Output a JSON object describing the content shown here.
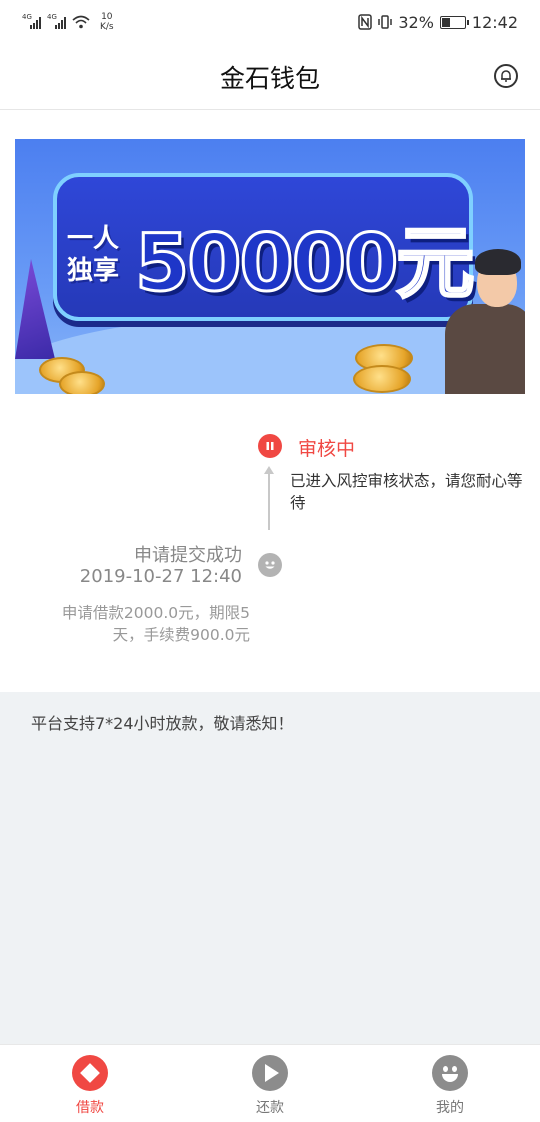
{
  "status_bar": {
    "signal1_label": "4G",
    "signal2_label": "4G",
    "speed_value": "10",
    "speed_unit": "K/s",
    "battery_percent": "32%",
    "time": "12:42",
    "nfc_icon": "nfc-icon",
    "vibrate_icon": "vibrate-icon"
  },
  "header": {
    "title": "金石钱包",
    "bell_icon": "bell-icon"
  },
  "banner": {
    "small_text_line1": "一人",
    "small_text_line2": "独享",
    "amount_text": "50000元"
  },
  "timeline": {
    "review": {
      "title": "审核中",
      "description": "已进入风控审核状态，请您耐心等待",
      "icon": "pause-icon"
    },
    "submitted": {
      "title": "申请提交成功",
      "time": "2019-10-27 12:40",
      "description": "申请借款2000.0元，期限5天，手续费900.0元",
      "icon": "smile-icon"
    }
  },
  "notice": {
    "text": "平台支持7*24小时放款，敬请悉知！"
  },
  "bottom_nav": {
    "items": [
      {
        "label": "借款",
        "icon": "diamond-icon",
        "active": true
      },
      {
        "label": "还款",
        "icon": "play-icon",
        "active": false
      },
      {
        "label": "我的",
        "icon": "smile-icon",
        "active": false
      }
    ]
  },
  "colors": {
    "accent": "#f04843",
    "inactive": "#8c8c8c",
    "notice_bg": "#eff2f4",
    "banner_blue": "#4c7ff0"
  }
}
